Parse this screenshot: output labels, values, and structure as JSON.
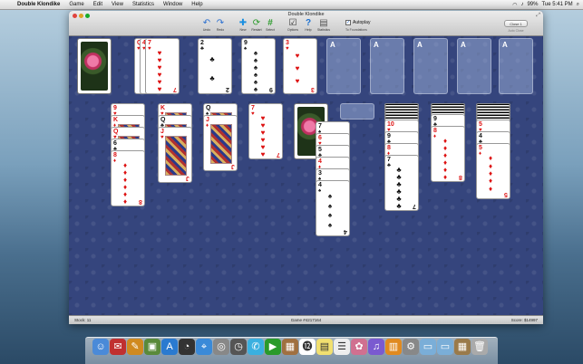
{
  "menubar": {
    "app": "Double Klondike",
    "items": [
      "Game",
      "Edit",
      "View",
      "Statistics",
      "Window",
      "Help"
    ],
    "battery": "99%",
    "clock": "Tue 5:41 PM"
  },
  "window": {
    "title": "Double Klondike",
    "toolbar": [
      {
        "label": "Undo",
        "icon": "undo-arrow-icon",
        "glyph": "↶"
      },
      {
        "label": "Redo",
        "icon": "redo-arrow-icon",
        "glyph": "↷"
      },
      {
        "label": "New",
        "icon": "plus-icon",
        "glyph": "✚"
      },
      {
        "label": "Restart",
        "icon": "restart-icon",
        "glyph": "⟳"
      },
      {
        "label": "Select",
        "icon": "hash-icon",
        "glyph": "#"
      },
      {
        "label": "Options",
        "icon": "checkbox-icon",
        "glyph": "☑"
      },
      {
        "label": "Help",
        "icon": "help-icon",
        "glyph": "?"
      },
      {
        "label": "Statistics",
        "icon": "chart-icon",
        "glyph": "▤"
      }
    ],
    "autoplay_label": "Autoplay",
    "autoplay_checked": true,
    "to_foundations": "To Foundations",
    "undo_button": "Close 1",
    "undo_sub": "Auto Close"
  },
  "status": {
    "stock": "Stock: 11",
    "game": "Game #4217164",
    "score": "Score: $14997"
  },
  "waste": [
    {
      "rank": "Q",
      "suit": "♥",
      "color": "red"
    },
    {
      "rank": "4",
      "suit": "♥",
      "color": "red"
    },
    {
      "rank": "7",
      "suit": "♥",
      "color": "red"
    }
  ],
  "top_row": [
    {
      "rank": "2",
      "suit": "♣",
      "color": "blk"
    },
    {
      "rank": "9",
      "suit": "♠",
      "color": "blk"
    },
    {
      "rank": "3",
      "suit": "♥",
      "color": "red"
    }
  ],
  "foundations": [
    "A",
    "A",
    "A",
    "A",
    "A"
  ],
  "tableau": [
    {
      "cards": [
        {
          "rank": "9",
          "suit": "♥",
          "color": "red"
        },
        {
          "rank": "K",
          "suit": "♦",
          "color": "red"
        },
        {
          "rank": "Q",
          "suit": "♥",
          "color": "red"
        },
        {
          "rank": "6",
          "suit": "♣",
          "color": "blk"
        },
        {
          "rank": "8",
          "suit": "♦",
          "color": "red"
        }
      ]
    },
    {
      "cards": [
        {
          "rank": "K",
          "suit": "♥",
          "color": "red"
        },
        {
          "rank": "Q",
          "suit": "♣",
          "color": "blk"
        },
        {
          "rank": "J",
          "suit": "♥",
          "color": "red"
        }
      ]
    },
    {
      "cards": [
        {
          "rank": "Q",
          "suit": "♠",
          "color": "blk"
        },
        {
          "rank": "J",
          "suit": "♦",
          "color": "red"
        }
      ]
    },
    {
      "cards": [
        {
          "rank": "7",
          "suit": "♥",
          "color": "red"
        }
      ]
    },
    {
      "cards": [
        {
          "rank": "7",
          "suit": "♠",
          "color": "blk"
        },
        {
          "rank": "6",
          "suit": "♥",
          "color": "red"
        },
        {
          "rank": "5",
          "suit": "♣",
          "color": "blk"
        },
        {
          "rank": "4",
          "suit": "♦",
          "color": "red"
        },
        {
          "rank": "3",
          "suit": "♠",
          "color": "blk"
        },
        {
          "rank": "4",
          "suit": "♠",
          "color": "blk"
        }
      ]
    },
    {
      "cards": []
    },
    {
      "cards": [
        {
          "rank": "10",
          "suit": "♥",
          "color": "red"
        },
        {
          "rank": "9",
          "suit": "♣",
          "color": "blk"
        },
        {
          "rank": "8",
          "suit": "♦",
          "color": "red"
        },
        {
          "rank": "7",
          "suit": "♣",
          "color": "blk"
        }
      ]
    },
    {
      "cards": [
        {
          "rank": "9",
          "suit": "♣",
          "color": "blk"
        },
        {
          "rank": "8",
          "suit": "♦",
          "color": "red"
        }
      ]
    },
    {
      "cards": [
        {
          "rank": "5",
          "suit": "♥",
          "color": "red"
        },
        {
          "rank": "4",
          "suit": "♣",
          "color": "blk"
        },
        {
          "rank": "5",
          "suit": "♦",
          "color": "red"
        }
      ]
    }
  ],
  "dock_icons": [
    "finder-icon",
    "mail-icon",
    "pen-icon",
    "photo-icon",
    "app-store-icon",
    "dashboard-icon",
    "safari-icon",
    "compass-icon",
    "clock-icon",
    "messages-icon",
    "facetime-icon",
    "contacts-icon",
    "calendar-icon",
    "notes-icon",
    "reminders-icon",
    "photos-icon",
    "itunes-icon",
    "ibooks-icon",
    "preferences-icon",
    "folder-icon",
    "folder-icon-2",
    "documents-icon",
    "trash-icon"
  ],
  "colors": {
    "felt": "#35457d",
    "red": "#d11",
    "black": "#111"
  }
}
